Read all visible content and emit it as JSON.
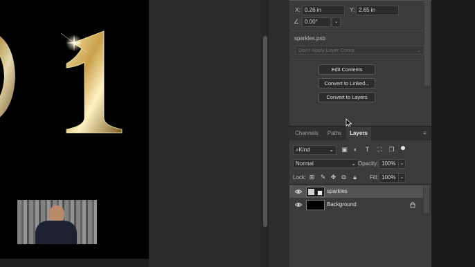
{
  "properties": {
    "x_label": "X:",
    "x_value": "0.26 in",
    "y_label": "Y:",
    "y_value": "2.65 in",
    "angle_value": "0.00°",
    "filename": "sparkles.psb",
    "layer_comp_placeholder": "Don't Apply Layer Comp",
    "buttons": {
      "edit_contents": "Edit Contents",
      "convert_linked": "Convert to Linked...",
      "convert_layers": "Convert to Layers"
    }
  },
  "tabs": {
    "channels": "Channels",
    "paths": "Paths",
    "layers": "Layers"
  },
  "layers_panel": {
    "filter_kind": "Kind",
    "blend_mode": "Normal",
    "opacity_label": "Opacity:",
    "opacity_value": "100%",
    "lock_label": "Lock:",
    "fill_label": "Fill:",
    "fill_value": "100%",
    "layers": [
      {
        "name": "sparkles",
        "selected": true
      },
      {
        "name": "Background",
        "selected": false,
        "locked": true
      }
    ]
  },
  "colors": {
    "panel_bg": "#3b3b3b",
    "canvas_bg": "#000000",
    "gold": "#d8b45a",
    "selection": "#545454"
  }
}
